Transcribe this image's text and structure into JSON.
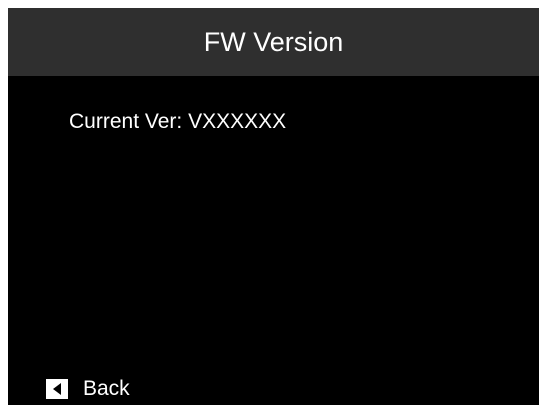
{
  "header": {
    "title": "FW Version"
  },
  "content": {
    "current_version_label": "Current Ver:",
    "current_version_value": "VXXXXXX"
  },
  "footer": {
    "back_label": "Back",
    "back_icon": "triangle-left-icon"
  },
  "colors": {
    "background": "#000000",
    "title_bar": "#2f2f2f",
    "text": "#ffffff"
  }
}
